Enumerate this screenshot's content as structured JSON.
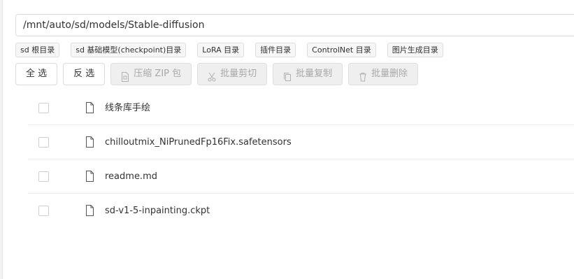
{
  "path": {
    "value": "/mnt/auto/sd/models/Stable-diffusion"
  },
  "quick_dirs": [
    {
      "label": "sd 根目录"
    },
    {
      "label": "sd 基础模型(checkpoint)目录"
    },
    {
      "label": "LoRA 目录"
    },
    {
      "label": "插件目录"
    },
    {
      "label": "ControlNet 目录"
    },
    {
      "label": "图片生成目录"
    }
  ],
  "toolbar": {
    "select_all": "全 选",
    "invert": "反 选",
    "zip": "压缩 ZIP 包",
    "cut": "批量剪切",
    "copy": "批量复制",
    "delete": "批量删除"
  },
  "files": [
    {
      "name": "线条库手绘",
      "checked": false
    },
    {
      "name": "chilloutmix_NiPrunedFp16Fix.safetensors",
      "checked": false
    },
    {
      "name": "readme.md",
      "checked": false
    },
    {
      "name": "sd-v1-5-inpainting.ckpt",
      "checked": false
    }
  ],
  "icons": {
    "file": "file-icon",
    "zip": "zip-file-icon",
    "cut": "scissors-icon",
    "copy": "copy-icon",
    "delete": "trash-icon"
  }
}
